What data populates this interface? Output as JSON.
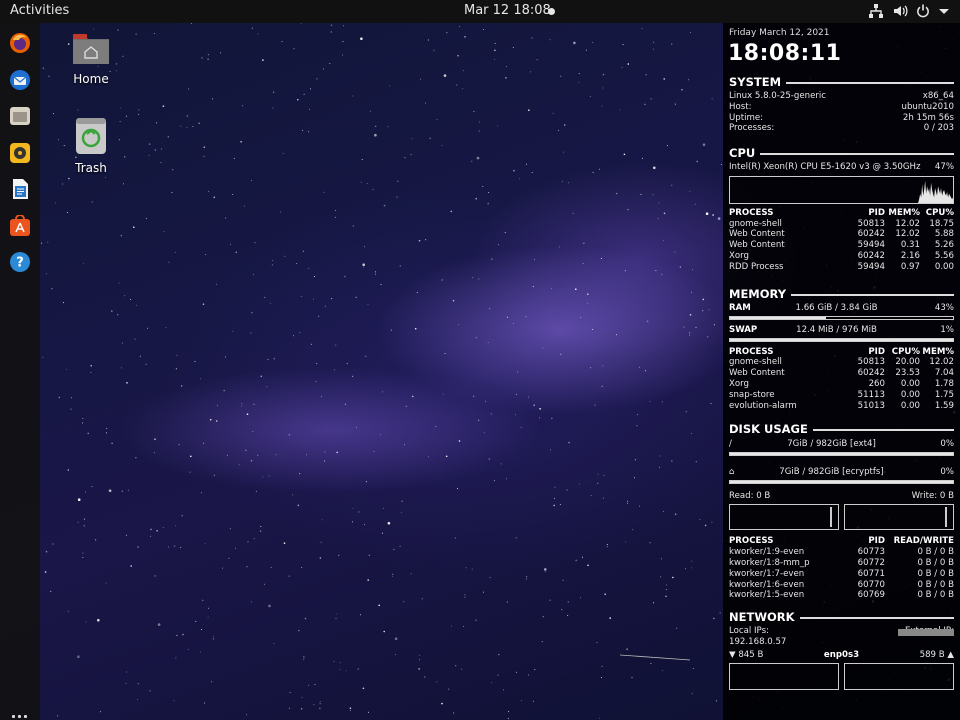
{
  "topbar": {
    "activities": "Activities",
    "clock": "Mar 12  18:08",
    "tray_icons": [
      "network-icon",
      "volume-icon",
      "power-icon",
      "chevron-down-icon"
    ]
  },
  "dock": {
    "items": [
      "firefox-icon",
      "thunderbird-icon",
      "files-icon",
      "rhythmbox-icon",
      "libreoffice-writer-icon",
      "software-center-icon",
      "help-icon"
    ],
    "show_apps": "apps-grid-icon"
  },
  "desktop": {
    "icons": [
      {
        "label": "Home",
        "icon": "home-folder-icon"
      },
      {
        "label": "Trash",
        "icon": "trash-icon"
      }
    ]
  },
  "conky": {
    "date": "Friday March 12, 2021",
    "time": "18:08:11",
    "system": {
      "title": "SYSTEM",
      "rows": [
        {
          "label": "Linux 5.8.0-25-generic",
          "value": "x86_64"
        },
        {
          "label": "Host:",
          "value": "ubuntu2010"
        },
        {
          "label": "Uptime:",
          "value": "2h 15m 56s"
        },
        {
          "label": "Processes:",
          "value": "0 / 203"
        }
      ]
    },
    "cpu": {
      "title": "CPU",
      "model": "Intel(R) Xeon(R) CPU E5-1620 v3 @ 3.50GHz",
      "usage": "47%",
      "usage_fraction": 0.47,
      "table": {
        "headers": [
          "PROCESS",
          "PID",
          "MEM%",
          "CPU%"
        ],
        "rows": [
          [
            "gnome-shell",
            "50813",
            "12.02",
            "18.75"
          ],
          [
            "Web Content",
            "60242",
            "12.02",
            "5.88"
          ],
          [
            "Web Content",
            "59494",
            "0.31",
            "5.26"
          ],
          [
            "Xorg",
            "60242",
            "2.16",
            "5.56"
          ],
          [
            "RDD Process",
            "59494",
            "0.97",
            "0.00"
          ]
        ]
      }
    },
    "memory": {
      "title": "MEMORY",
      "ram_label": "RAM",
      "ram_value": "1.66 GiB / 3.84 GiB",
      "ram_percent": "43%",
      "ram_fraction": 0.43,
      "swap_label": "SWAP",
      "swap_value": "12.4 MiB / 976 MiB",
      "swap_percent": "1%",
      "swap_fraction": 0.01,
      "table": {
        "headers": [
          "PROCESS",
          "PID",
          "CPU%",
          "MEM%"
        ],
        "rows": [
          [
            "gnome-shell",
            "50813",
            "20.00",
            "12.02"
          ],
          [
            "Web Content",
            "60242",
            "23.53",
            "7.04"
          ],
          [
            "Xorg",
            "260",
            "0.00",
            "1.78"
          ],
          [
            "snap-store",
            "51113",
            "0.00",
            "1.75"
          ],
          [
            "evolution-alarm",
            "51013",
            "0.00",
            "1.59"
          ]
        ]
      }
    },
    "disk": {
      "title": "DISK USAGE",
      "mounts": [
        {
          "mount": "/",
          "value": "7GiB / 982GiB [ext4]",
          "percent": "0%",
          "fraction": 0.0
        },
        {
          "mount": "⌂",
          "value": "7GiB / 982GiB [ecryptfs]",
          "percent": "0%",
          "fraction": 0.0
        }
      ],
      "read": "Read: 0 B",
      "write": "Write: 0 B",
      "table": {
        "headers": [
          "PROCESS",
          "PID",
          "READ/WRITE"
        ],
        "rows": [
          [
            "kworker/1:9-even",
            "60773",
            "0 B / 0 B"
          ],
          [
            "kworker/1:8-mm_p",
            "60772",
            "0 B / 0 B"
          ],
          [
            "kworker/1:7-even",
            "60771",
            "0 B / 0 B"
          ],
          [
            "kworker/1:6-even",
            "60770",
            "0 B / 0 B"
          ],
          [
            "kworker/1:5-even",
            "60769",
            "0 B / 0 B"
          ]
        ]
      }
    },
    "network": {
      "title": "NETWORK",
      "local_label": "Local IPs:",
      "local_ip": "192.168.0.57",
      "external_label": "External IP:",
      "down": "▼ 845 B",
      "interface": "enp0s3",
      "up": "589 B ▲"
    }
  }
}
